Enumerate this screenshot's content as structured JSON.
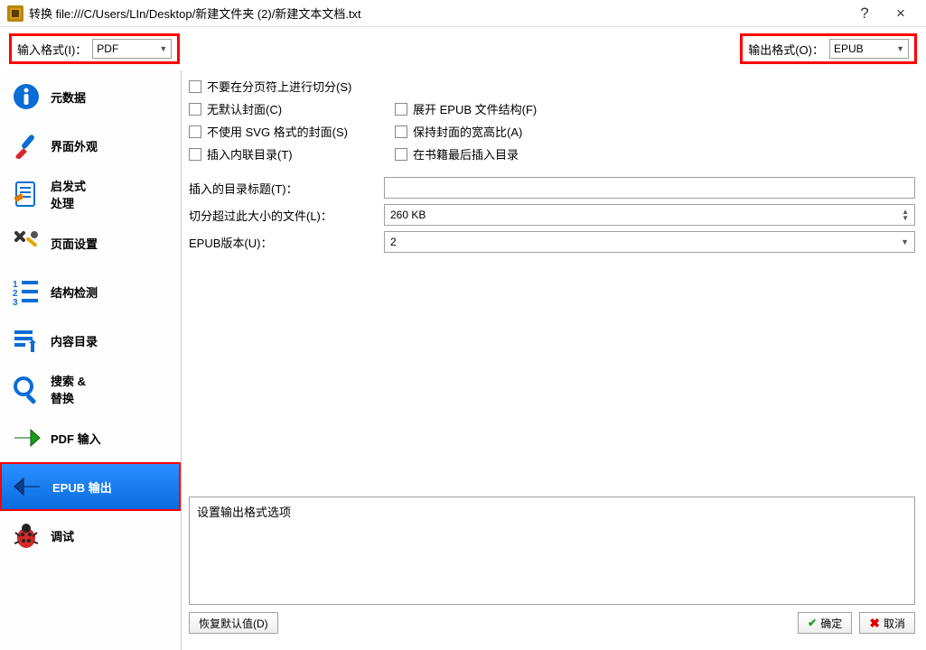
{
  "window": {
    "title": "转换 file:///C/Users/LIn/Desktop/新建文件夹 (2)/新建文本文档.txt",
    "help": "?",
    "close": "×"
  },
  "format": {
    "input_label": "输入格式(I)：",
    "input_value": "PDF",
    "output_label": "输出格式(O)：",
    "output_value": "EPUB"
  },
  "sidebar": {
    "items": [
      {
        "label": "元数据"
      },
      {
        "label": "界面外观"
      },
      {
        "label": "启发式\n处理"
      },
      {
        "label": "页面设置"
      },
      {
        "label": "结构检测"
      },
      {
        "label": "内容目录"
      },
      {
        "label": "搜索 &\n替换"
      },
      {
        "label": "PDF 输入"
      },
      {
        "label": "EPUB 输出"
      },
      {
        "label": "调试"
      }
    ]
  },
  "options": {
    "no_split_pagebreak": "不要在分页符上进行切分(S)",
    "no_default_cover": "无默认封面(C)",
    "expand_epub": "展开 EPUB 文件结构(F)",
    "no_svg_cover": "不使用 SVG 格式的封面(S)",
    "keep_cover_ratio": "保持封面的宽高比(A)",
    "insert_inline_toc": "插入内联目录(T)",
    "toc_at_end": "在书籍最后插入目录",
    "inserted_toc_title_label": "插入的目录标题(T)：",
    "inserted_toc_title_value": "",
    "split_size_label": "切分超过此大小的文件(L)：",
    "split_size_value": "260 KB",
    "epub_version_label": "EPUB版本(U)：",
    "epub_version_value": "2"
  },
  "desc": "设置输出格式选项",
  "footer": {
    "restore": "恢复默认值(D)",
    "ok": "确定",
    "cancel": "取消"
  },
  "icons": {
    "metadata": "info-circle",
    "look": "brush",
    "heuristic": "heuristic",
    "page": "wrench-screwdriver",
    "structure": "list-123",
    "toc": "hand-click",
    "search": "magnifier",
    "pdf": "arrow-right-green",
    "epub": "arrow-left-blue",
    "debug": "bug"
  }
}
